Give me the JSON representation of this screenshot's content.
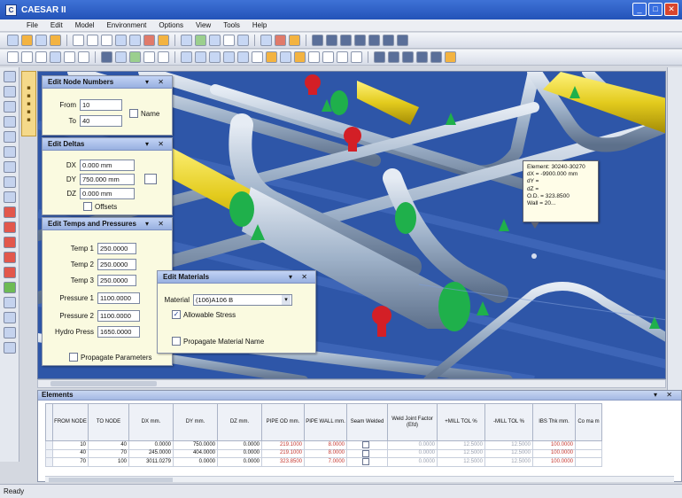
{
  "app": {
    "title": "CAESAR II",
    "status": "Ready"
  },
  "menu": [
    "File",
    "Edit",
    "Model",
    "Environment",
    "Options",
    "View",
    "Tools",
    "Help"
  ],
  "node_numbers": {
    "title": "Edit Node Numbers",
    "from_label": "From",
    "from_value": "10",
    "to_label": "To",
    "to_value": "40",
    "name_label": "Name"
  },
  "deltas": {
    "title": "Edit Deltas",
    "dx_label": "DX",
    "dx_value": "0.000 mm",
    "dy_label": "DY",
    "dy_value": "750.000 mm",
    "dz_label": "DZ",
    "dz_value": "0.000 mm",
    "offsets_label": "Offsets"
  },
  "temps": {
    "title": "Edit Temps and Pressures",
    "temp1_label": "Temp 1",
    "temp1_value": "250.0000",
    "temp2_label": "Temp 2",
    "temp2_value": "250.0000",
    "temp3_label": "Temp 3",
    "temp3_value": "250.0000",
    "press1_label": "Pressure 1",
    "press1_value": "1100.0000",
    "press2_label": "Pressure 2",
    "press2_value": "1100.0000",
    "hydro_label": "Hydro Press",
    "hydro_value": "1650.0000",
    "propagate_label": "Propagate Parameters"
  },
  "materials": {
    "title": "Edit Materials",
    "material_label": "Material",
    "material_value": "(106)A106 B",
    "allowable_label": "Allowable Stress",
    "propagate_label": "Propagate Material Name"
  },
  "tooltip": {
    "lines": [
      "Element: 30240-30270",
      "dX = -9900.000 mm",
      "dY =",
      "dZ =",
      "O.D. = 323.8500",
      "Wall = 20..."
    ]
  },
  "elements": {
    "title": "Elements",
    "columns": [
      "FROM NODE",
      "TO NODE",
      "DX mm.",
      "DY mm.",
      "DZ mm.",
      "PIPE OD mm.",
      "PIPE WALL mm.",
      "Seam Welded",
      "Weld Joint Factor (Efd)",
      "+MILL TOL %",
      "-MILL TOL %",
      "IBS Thk mm.",
      "Co ma m"
    ],
    "rows": [
      [
        "10",
        "40",
        "0.0000",
        "750.0000",
        "0.0000",
        "219.1000",
        "8.0000",
        "",
        "0.0000",
        "12.5000",
        "12.5000",
        "100.0000",
        ""
      ],
      [
        "40",
        "70",
        "245.0000",
        "404.0000",
        "0.0000",
        "219.1000",
        "8.0000",
        "",
        "0.0000",
        "12.5000",
        "12.5000",
        "100.0000",
        ""
      ],
      [
        "70",
        "100",
        "3011.0279",
        "0.0000",
        "0.0000",
        "323.8500",
        "7.0000",
        "",
        "0.0000",
        "12.5000",
        "12.5000",
        "100.0000",
        ""
      ]
    ]
  }
}
